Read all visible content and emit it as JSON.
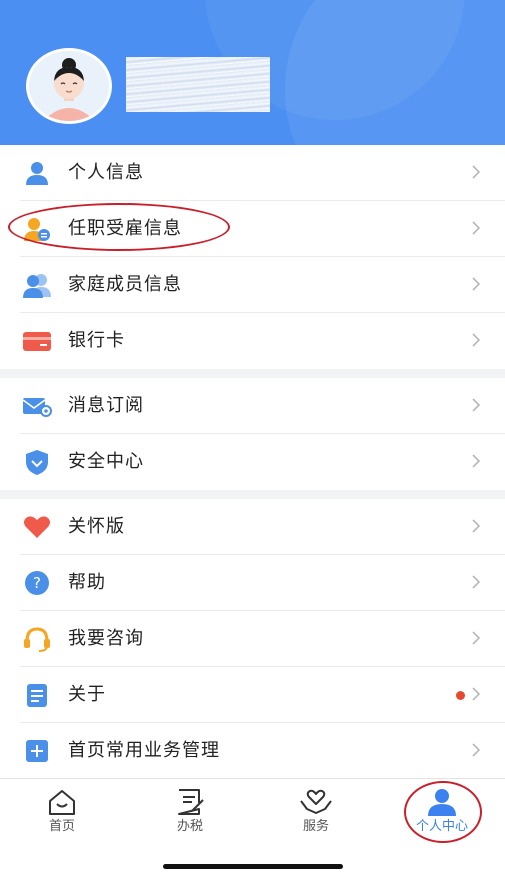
{
  "profile": {
    "avatar_icon": "female-avatar-icon",
    "username_redacted": true
  },
  "menu": {
    "group1": [
      {
        "label": "个人信息",
        "icon": "person-icon"
      },
      {
        "label": "任职受雇信息",
        "icon": "employment-icon"
      },
      {
        "label": "家庭成员信息",
        "icon": "family-icon"
      },
      {
        "label": "银行卡",
        "icon": "bank-card-icon"
      }
    ],
    "group2": [
      {
        "label": "消息订阅",
        "icon": "mail-subscribe-icon"
      },
      {
        "label": "安全中心",
        "icon": "shield-icon"
      }
    ],
    "group3": [
      {
        "label": "关怀版",
        "icon": "heart-icon"
      },
      {
        "label": "帮助",
        "icon": "help-icon"
      },
      {
        "label": "我要咨询",
        "icon": "headset-icon"
      },
      {
        "label": "关于",
        "icon": "document-icon",
        "badge": "red-dot"
      },
      {
        "label": "首页常用业务管理",
        "icon": "plus-square-icon"
      }
    ]
  },
  "tabbar": {
    "tabs": [
      {
        "label": "首页",
        "icon": "home-icon"
      },
      {
        "label": "办税",
        "icon": "tax-form-icon"
      },
      {
        "label": "服务",
        "icon": "service-hands-icon"
      },
      {
        "label": "个人中心",
        "icon": "user-center-icon",
        "active": true
      }
    ]
  },
  "colors": {
    "header_bg": "#4b8ff2",
    "accent": "#3b82f0",
    "annotation": "#c8202a",
    "badge": "#e6492d"
  }
}
